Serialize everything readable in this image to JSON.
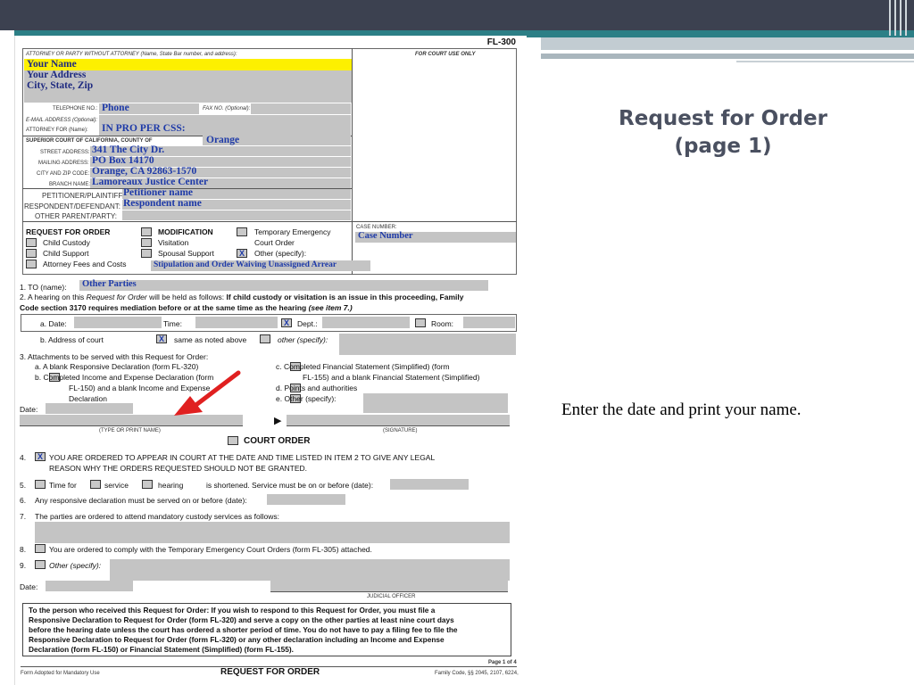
{
  "slide": {
    "title_line1": "Request for Order",
    "title_line2": "(page 1)",
    "instruction": "Enter the date and print your name."
  },
  "form": {
    "form_code": "FL-300",
    "header": {
      "attorney_label": "ATTORNEY OR PARTY WITHOUT ATTORNEY (Name, State Bar number, and address):",
      "court_use_label": "FOR COURT USE ONLY",
      "name": "Your Name",
      "address": "Your Address",
      "city_state_zip": "City, State, Zip",
      "telephone_label": "TELEPHONE NO.:",
      "telephone": "Phone",
      "fax_label": "FAX NO. (Optional):",
      "email_label": "E-MAIL ADDRESS (Optional):",
      "attorney_for_label": "ATTORNEY FOR (Name):",
      "attorney_for": "IN PRO PER    CSS:",
      "court_label": "SUPERIOR COURT OF CALIFORNIA, COUNTY OF",
      "county": "Orange",
      "street_label": "STREET ADDRESS:",
      "street": "341 The City Dr.",
      "mailing_label": "MAILING ADDRESS:",
      "mailing": "PO Box 14170",
      "city_zip_label": "CITY AND ZIP CODE:",
      "city_zip": "Orange, CA  92863-1570",
      "branch_label": "BRANCH NAME:",
      "branch": "Lamoreaux Justice Center",
      "petitioner_label": "PETITIONER/PLAINTIFF:",
      "petitioner": "Petitioner name",
      "respondent_label": "RESPONDENT/DEFENDANT:",
      "respondent": "Respondent name",
      "other_parent_label": "OTHER PARENT/PARTY:"
    },
    "request": {
      "title": "REQUEST FOR ORDER",
      "child_custody": "Child Custody",
      "child_support": "Child Support",
      "attorney_fees": "Attorney Fees and Costs",
      "modification": "MODIFICATION",
      "visitation": "Visitation",
      "spousal_support": "Spousal Support",
      "temp_emergency_1": "Temporary Emergency",
      "temp_emergency_2": "Court Order",
      "other_specify": "Other (specify):",
      "other_x": "X",
      "stipulation": "Stipulation and Order Waiving Unassigned Arrear",
      "case_number_label": "CASE NUMBER:",
      "case_number": "Case Number"
    },
    "item1": {
      "label": "1.   TO (name):",
      "value": "Other Parties"
    },
    "item2": {
      "line1_a": "2.   A hearing on this ",
      "line1_b": "Request for Order",
      "line1_c": " will be held as follows: ",
      "line1_d": "If child custody or visitation is an issue in this proceeding, Family",
      "line2_a": "Code section 3170 requires mediation before or at the same time as the hearing ",
      "line2_b": "(see item 7.)",
      "date_label": "a.  Date:",
      "time_label": "Time:",
      "dept_label": "Dept.:",
      "room_label": "Room:",
      "dept_x": "X",
      "address_label": "b.  Address of court",
      "same_x": "X",
      "same_label": "same as noted above",
      "other_label": "other (specify):"
    },
    "item3": {
      "title": "3.   Attachments to be served with this Request for Order:",
      "a": "a.   A blank Responsive Declaration (form FL-320)",
      "b1": "b.        Completed Income and Expense Declaration (form",
      "b2": "FL-150) and a blank Income and Expense",
      "b3": "Declaration",
      "c1": "c.        Completed Financial Statement (Simplified) (form",
      "c2": "FL-155) and a blank Financial Statement (Simplified)",
      "d": "d.        Points and authorities",
      "e": "e.        Other (specify):"
    },
    "signature": {
      "date_label": "Date:",
      "type_name_label": "(TYPE OR PRINT NAME)",
      "signature_label": "(SIGNATURE)"
    },
    "court_order": {
      "title": "COURT ORDER",
      "item4_x": "X",
      "item4_1": "YOU ARE ORDERED TO APPEAR IN COURT AT THE DATE AND TIME LISTED IN ITEM 2 TO GIVE ANY LEGAL",
      "item4_2": "REASON WHY THE ORDERS REQUESTED SHOULD NOT BE GRANTED.",
      "item5_a": "Time for",
      "item5_b": "service",
      "item5_c": "hearing",
      "item5_d": "is shortened. Service must be on or before (date):",
      "item6": "Any responsive declaration must be served on or before (date):",
      "item7": "The parties are ordered to attend mandatory custody services as follows:",
      "item8": "You are ordered to comply with the Temporary Emergency Court Orders (form FL-305) attached.",
      "item9": "Other (specify):",
      "date_label": "Date:",
      "judicial_officer": "JUDICIAL OFFICER"
    },
    "notice": {
      "line1": "To the person who received this Request for Order: If you wish to respond to this Request for Order, you must file a",
      "line2": "Responsive Declaration to Request for Order (form FL-320) and serve a copy on the other parties at least nine court days",
      "line3": "before the hearing date unless the court has ordered a shorter period of time. You do not have to pay a filing fee to file the",
      "line4": "Responsive Declaration to Request for Order (form FL-320) or any other declaration including an Income and Expense",
      "line5": "Declaration (form FL-150) or Financial Statement (Simplified) (form FL-155)."
    },
    "footer": {
      "page": "Page 1 of 4",
      "adopted": "Form Adopted for Mandatory Use",
      "title": "REQUEST FOR ORDER",
      "family_code": "Family Code, §§ 2045, 2107, 6224,"
    }
  }
}
